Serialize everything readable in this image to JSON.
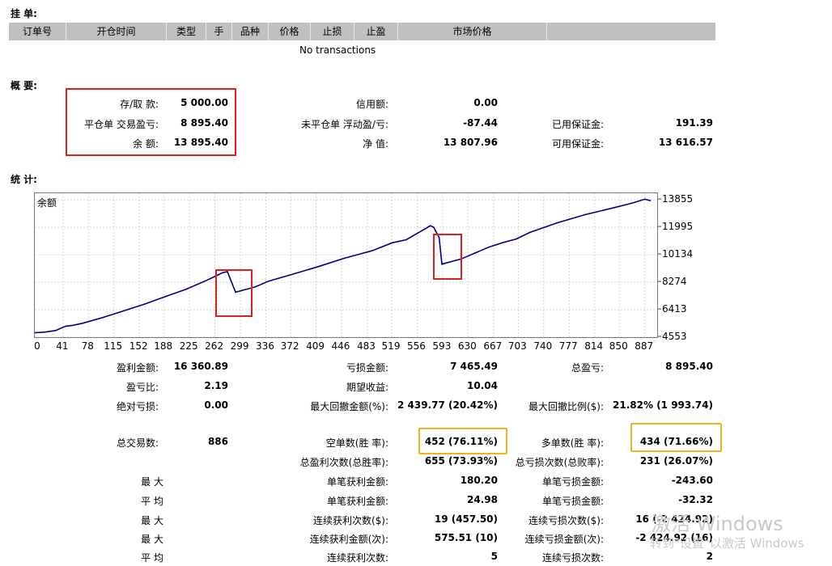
{
  "pending_orders": {
    "title": "挂 单:",
    "columns": [
      "订单号",
      "开仓时间",
      "类型",
      "手",
      "品种",
      "价格",
      "止损",
      "止盈",
      "市场价格",
      ""
    ],
    "empty_text": "No transactions"
  },
  "summary": {
    "title": "概 要:",
    "deposit": {
      "label": "存/取 款:",
      "value": "5 000.00"
    },
    "closed_pl": {
      "label": "平仓单 交易盈亏:",
      "value": "8 895.40"
    },
    "balance": {
      "label": "余 额:",
      "value": "13 895.40"
    },
    "credit": {
      "label": "信用额:",
      "value": "0.00"
    },
    "floating_pl": {
      "label": "未平仓单 浮动盈/亏:",
      "value": "-87.44"
    },
    "equity": {
      "label": "净 值:",
      "value": "13 807.96"
    },
    "margin": {
      "label": "已用保证金:",
      "value": "191.39"
    },
    "free_margin": {
      "label": "可用保证金:",
      "value": "13 616.57"
    }
  },
  "stats": {
    "title": "统 计:",
    "gross_profit": {
      "label": "盈利金额:",
      "value": "16 360.89"
    },
    "gross_loss": {
      "label": "亏损金额:",
      "value": "7 465.49"
    },
    "total_net_profit": {
      "label": "总盈亏:",
      "value": "8 895.40"
    },
    "profit_factor": {
      "label": "盈亏比:",
      "value": "2.19"
    },
    "expected_payoff": {
      "label": "期望收益:",
      "value": "10.04"
    },
    "absolute_drawdown": {
      "label": "绝对亏损:",
      "value": "0.00"
    },
    "maximal_drawdown": {
      "label": "最大回撤金额(%):",
      "value": "2 439.77 (20.42%)"
    },
    "relative_drawdown": {
      "label": "最大回撤比例($):",
      "value": "21.82% (1 993.74)"
    },
    "total_trades": {
      "label": "总交易数:",
      "value": "886"
    },
    "short_positions": {
      "label": "空单数(胜 率):",
      "value": "452 (76.11%)"
    },
    "long_positions": {
      "label": "多单数(胜 率):",
      "value": "434 (71.66%)"
    },
    "profit_trades": {
      "label": "总盈利次数(总胜率):",
      "value": "655 (73.93%)"
    },
    "loss_trades": {
      "label": "总亏损次数(总败率):",
      "value": "231 (26.07%)"
    },
    "row_largest": {
      "label": "最 大"
    },
    "largest_profit": {
      "label": "单笔获利金额:",
      "value": "180.20"
    },
    "largest_loss": {
      "label": "单笔亏损金额:",
      "value": "-243.60"
    },
    "row_average": {
      "label": "平 均"
    },
    "average_profit": {
      "label": "单笔获利金额:",
      "value": "24.98"
    },
    "average_loss": {
      "label": "单笔亏损金额:",
      "value": "-32.32"
    },
    "row_max": {
      "label": "最 大"
    },
    "max_consec_wins": {
      "label": "连续获利次数($):",
      "value": "19 (457.50)"
    },
    "max_consec_losses": {
      "label": "连续亏损次数($):",
      "value": "16 (-2 424.92)"
    },
    "row_maximal": {
      "label": "最 大"
    },
    "maximal_consec_profit": {
      "label": "连续获利金额(次):",
      "value": "575.51 (10)"
    },
    "maximal_consec_loss": {
      "label": "连续亏损金额(次):",
      "value": "-2 424.92 (16)"
    },
    "row_avg2": {
      "label": "平 均"
    },
    "avg_consec_wins": {
      "label": "连续获利次数:",
      "value": "5"
    },
    "avg_consec_losses": {
      "label": "连续亏损次数:",
      "value": "2"
    }
  },
  "watermark": {
    "line1": "激活 Windows",
    "line2": "转到\"设置\"以激活 Windows"
  },
  "chart_data": {
    "type": "line",
    "title": "余额",
    "xlabel": "",
    "ylabel": "",
    "xlim": [
      0,
      905
    ],
    "ylim": [
      4553,
      14300
    ],
    "x_ticks": [
      0,
      41,
      78,
      115,
      152,
      188,
      225,
      262,
      299,
      336,
      372,
      409,
      446,
      483,
      519,
      556,
      593,
      630,
      667,
      703,
      740,
      777,
      814,
      850,
      887
    ],
    "y_ticks": [
      4553,
      6413,
      8274,
      10134,
      11995,
      13855
    ],
    "line_color": "#000080",
    "grid": true,
    "series": [
      {
        "name": "",
        "x": [
          0,
          15,
          30,
          45,
          55,
          70,
          100,
          130,
          160,
          190,
          220,
          250,
          268,
          272,
          280,
          285,
          292,
          300,
          320,
          340,
          370,
          410,
          450,
          490,
          520,
          540,
          568,
          575,
          580,
          588,
          592,
          600,
          620,
          640,
          660,
          680,
          700,
          720,
          760,
          800,
          840,
          870,
          887,
          895
        ],
        "y": [
          4850,
          4900,
          5000,
          5300,
          5350,
          5500,
          5900,
          6350,
          6800,
          7300,
          7800,
          8400,
          8800,
          8900,
          9000,
          8400,
          7600,
          7700,
          7950,
          8350,
          8750,
          9300,
          9900,
          10400,
          10950,
          11150,
          11900,
          12100,
          12000,
          11300,
          9500,
          9600,
          9850,
          10250,
          10650,
          10950,
          11200,
          11650,
          12300,
          12850,
          13300,
          13650,
          13900,
          13800
        ]
      }
    ]
  }
}
